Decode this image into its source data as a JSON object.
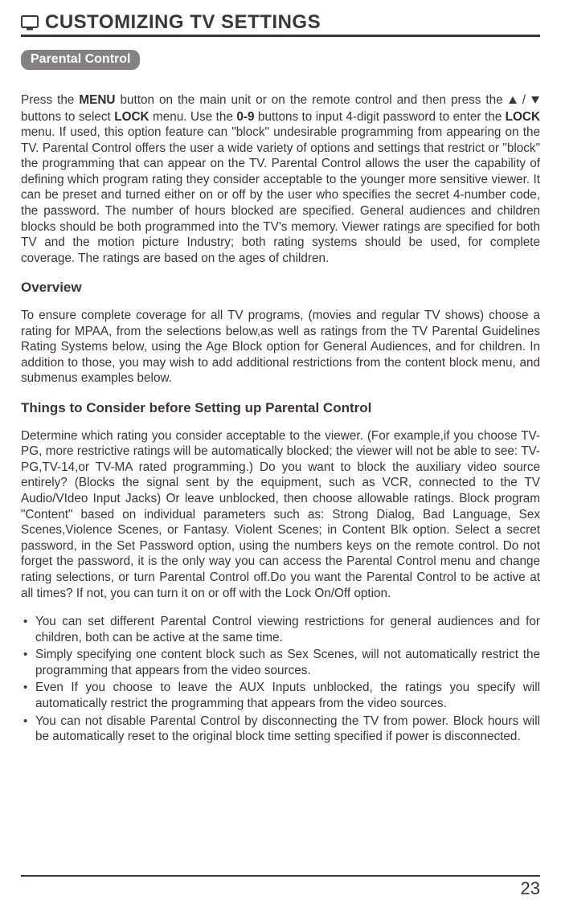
{
  "header": {
    "title": "CUSTOMIZING TV SETTINGS"
  },
  "tab": {
    "label": "Parental Control"
  },
  "intro": {
    "p1a": "Press the ",
    "menu": "MENU",
    "p1b": " button on the main unit or on the remote control and then press the ",
    "p1c": " buttons to select ",
    "lock": "LOCK",
    "p1d": " menu. Use the ",
    "digits": "0-9",
    "p1e": " buttons to input 4-digit password to enter the ",
    "lock2": "LOCK",
    "p1f": " menu. If used, this option feature can \"block\" undesirable programming from appearing on the TV. Parental Control offers the user a wide variety of options and settings that restrict or \"block\" the programming that can appear on the TV. Parental Control allows the user the capability of defining which program rating they consider acceptable to the younger more sensitive viewer. It can be preset and turned either on or off by the user who specifies the secret 4-number code, the password. The number of hours blocked are specified. General audiences and children blocks should be both programmed into the TV's memory. Viewer ratings are specified for both TV and the motion picture Industry; both rating systems should be used, for complete coverage. The ratings are based on the ages of children."
  },
  "overview": {
    "heading": "Overview",
    "body": "To ensure complete coverage for all TV programs, (movies and regular TV shows) choose a rating for MPAA, from the selections below,as well as ratings from the TV Parental Guidelines Rating Systems below, using the Age Block option for General Audiences, and for children. In addition to those, you may wish to add additional restrictions from the content block menu, and submenus examples below."
  },
  "consider": {
    "heading": "Things to Consider before Setting up Parental Control",
    "body": "Determine which rating you consider acceptable to the viewer. (For example,if you choose TV-PG, more restrictive ratings will be automatically blocked; the viewer will not be able to see: TV-PG,TV-14,or TV-MA rated programming.) Do you want to block the auxiliary video source entirely? (Blocks the signal sent by the equipment, such as VCR, connected to the TV Audio/VIdeo Input Jacks) Or leave unblocked, then choose allowable ratings. Block program \"Content\" based on individual parameters such as: Strong Dialog, Bad Language, Sex Scenes,Violence Scenes, or Fantasy. Violent Scenes; in Content Blk option. Select a secret password, in the Set Password option, using the numbers keys on the remote control. Do not forget the password, it is the only way you can access the Parental  Control menu and change rating selections, or turn Parental Control off.Do you want the Parental Control to be active at all times? If not, you can turn it on or off with the Lock On/Off option."
  },
  "bullets": [
    "You can set different Parental Control viewing restrictions for general audiences and for children, both can be active at the same time.",
    "Simply specifying one content block such as Sex Scenes, will not automatically restrict the programming that appears from the video sources.",
    "Even If you choose to leave the AUX Inputs unblocked, the ratings you specify will automatically restrict the programming that appears from the video sources.",
    "You can not disable Parental Control by disconnecting the TV from power. Block hours will be automatically reset to the original block time setting specified if power is disconnected."
  ],
  "pageNumber": "23"
}
